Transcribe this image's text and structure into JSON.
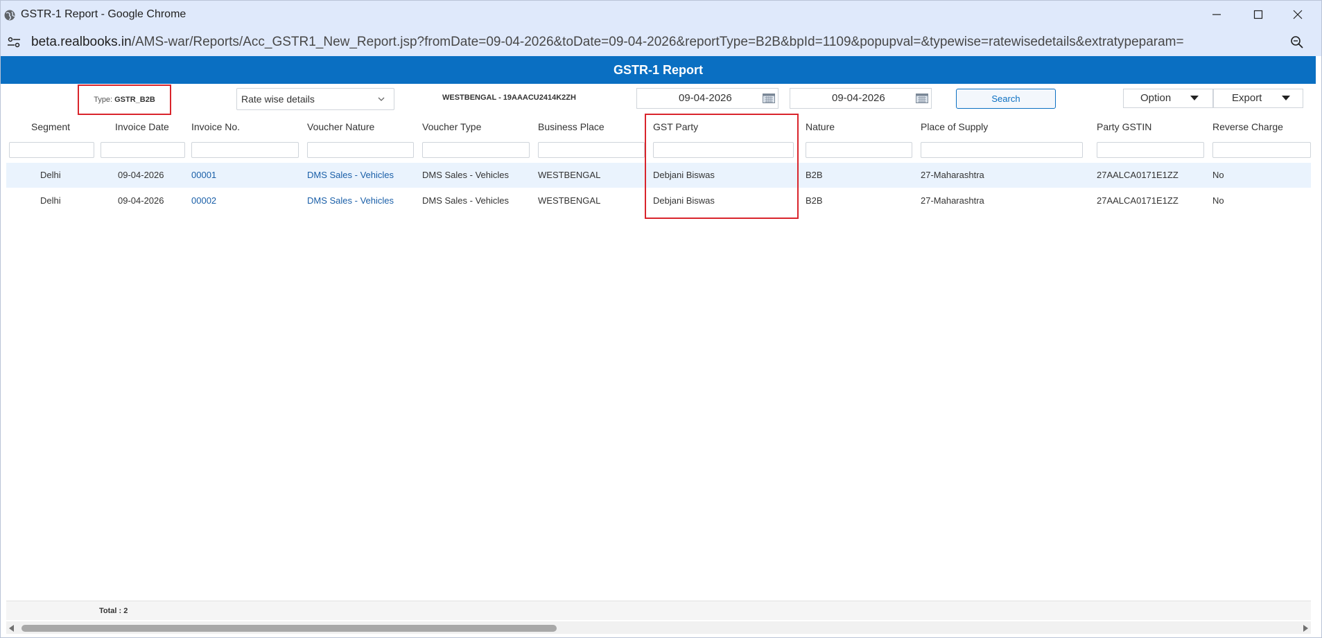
{
  "window": {
    "title": "GSTR-1 Report - Google Chrome",
    "minimize_icon": "minimize-icon",
    "maximize_icon": "maximize-icon",
    "close_icon": "close-icon"
  },
  "address": {
    "host": "beta.realbooks.in",
    "path": "/AMS-war/Reports/Acc_GSTR1_New_Report.jsp?fromDate=09-04-2026&toDate=09-04-2026&reportType=B2B&bpId=1109&popupval=&typewise=ratewisedetails&extratypeparam="
  },
  "report": {
    "title": "GSTR-1 Report",
    "type_label": "Type:",
    "type_value": "GSTR_B2B",
    "view_select": "Rate wise details",
    "gstin": "WESTBENGAL - 19AAACU2414K2ZH",
    "from_date": "09-04-2026",
    "to_date": "09-04-2026",
    "search_label": "Search",
    "option_label": "Option",
    "export_label": "Export"
  },
  "columns": [
    "Segment",
    "Invoice Date",
    "Invoice No.",
    "Voucher Nature",
    "Voucher Type",
    "Business Place",
    "GST Party",
    "Nature",
    "Place of Supply",
    "Party GSTIN",
    "Reverse Charge"
  ],
  "rows": [
    [
      "Delhi",
      "09-04-2026",
      "00001",
      "DMS Sales - Vehicles",
      "DMS Sales - Vehicles",
      "WESTBENGAL",
      "Debjani Biswas",
      "B2B",
      "27-Maharashtra",
      "27AALCA0171E1ZZ",
      "No"
    ],
    [
      "Delhi",
      "09-04-2026",
      "00002",
      "DMS Sales - Vehicles",
      "DMS Sales - Vehicles",
      "WESTBENGAL",
      "Debjani Biswas",
      "B2B",
      "27-Maharashtra",
      "27AALCA0171E1ZZ",
      "No"
    ]
  ],
  "footer": {
    "total": "Total : 2"
  },
  "colors": {
    "header_blue": "#0a6fc2",
    "highlight_red": "#d9242b",
    "row_highlight": "#eaf3fd"
  }
}
